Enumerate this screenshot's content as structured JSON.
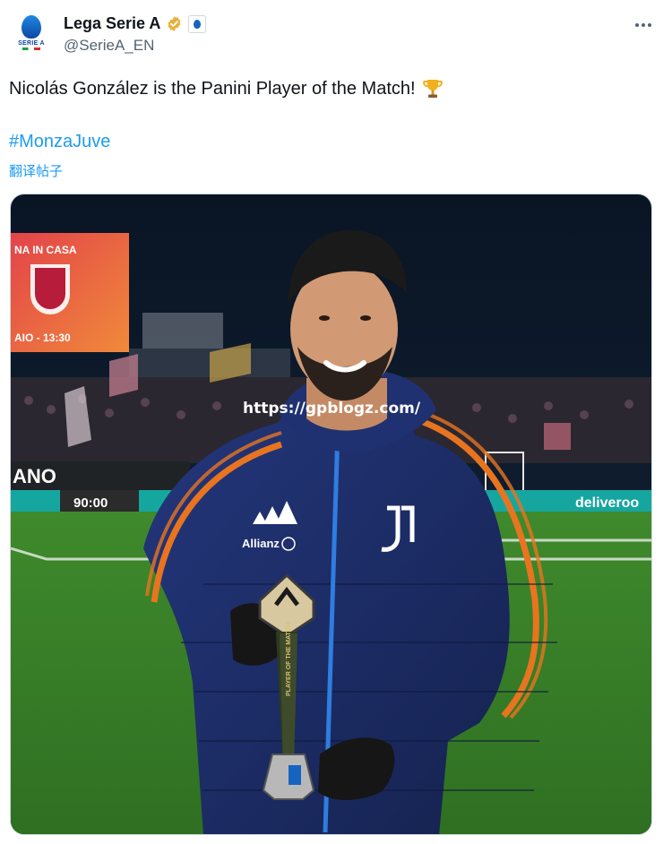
{
  "account": {
    "display_name": "Lega Serie A",
    "handle": "@SerieA_EN",
    "avatar_text": "SERIE A"
  },
  "tweet": {
    "text": "Nicolás González is the Panini Player of the Match!",
    "hashtag": "#MonzaJuve",
    "translate_label": "翻译帖子"
  },
  "media": {
    "scoreboard_line1": "NA IN CASA",
    "scoreboard_line2": "AIO - 13:30",
    "ad_board_left": "ANO",
    "ad_board_score": "90:00",
    "ad_board_right": "deliveroo",
    "jacket_brand": "Allianz",
    "trophy_text": "PLAYER OF THE MATCH",
    "watermark": "https://gpblogz.com/"
  },
  "colors": {
    "link": "#1d9bf0",
    "verified_gold": "#e8b13a",
    "jacket_navy": "#1c2d6b",
    "jacket_orange": "#e8741f",
    "pitch_green": "#3f8a2c"
  },
  "icons": {
    "verified": "verified-badge-icon",
    "affiliate": "serie-a-affiliate-icon",
    "more": "more-options-icon",
    "trophy": "trophy-emoji-icon"
  }
}
